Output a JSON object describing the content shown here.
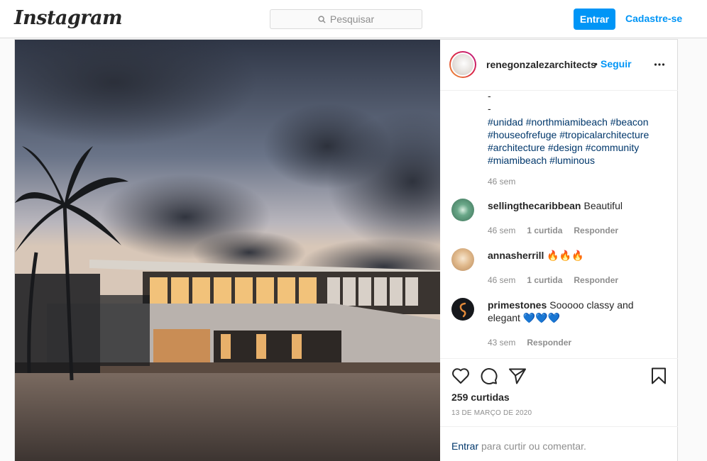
{
  "header": {
    "logo": "Instagram",
    "search_placeholder": "Pesquisar",
    "login_label": "Entrar",
    "signup_label": "Cadastre-se"
  },
  "post": {
    "username": "renegonzalezarchitects",
    "separator": "•",
    "follow_label": "Seguir",
    "caption_lines": [
      "-",
      "-",
      "#unidad #northmiamibeach #beacon",
      "#houseofrefuge #tropicalarchitecture",
      "#architecture #design #community",
      "#miamibeach #luminous"
    ],
    "caption_time": "46 sem",
    "comments": [
      {
        "user": "sellingthecaribbean",
        "text": "Beautiful",
        "time": "46 sem",
        "likes": "1 curtida",
        "reply": "Responder"
      },
      {
        "user": "annasherrill",
        "text": "🔥🔥🔥",
        "time": "46 sem",
        "likes": "1 curtida",
        "reply": "Responder"
      },
      {
        "user": "primestones",
        "text": "Sooooo classy and elegant 💙💙💙",
        "time": "43 sem",
        "likes": "",
        "reply": "Responder"
      }
    ],
    "likes_count": "259 curtidas",
    "date": "13 DE MARÇO DE 2020",
    "login_prompt_link": "Entrar",
    "login_prompt_text": " para curtir ou comentar."
  },
  "icons": [
    "search-icon",
    "more-options-icon",
    "heart-icon",
    "comment-icon",
    "share-icon",
    "bookmark-icon"
  ],
  "colors": {
    "accent": "#0095f6",
    "border": "#dbdbdb",
    "muted": "#8e8e8e",
    "link": "#00376b"
  }
}
